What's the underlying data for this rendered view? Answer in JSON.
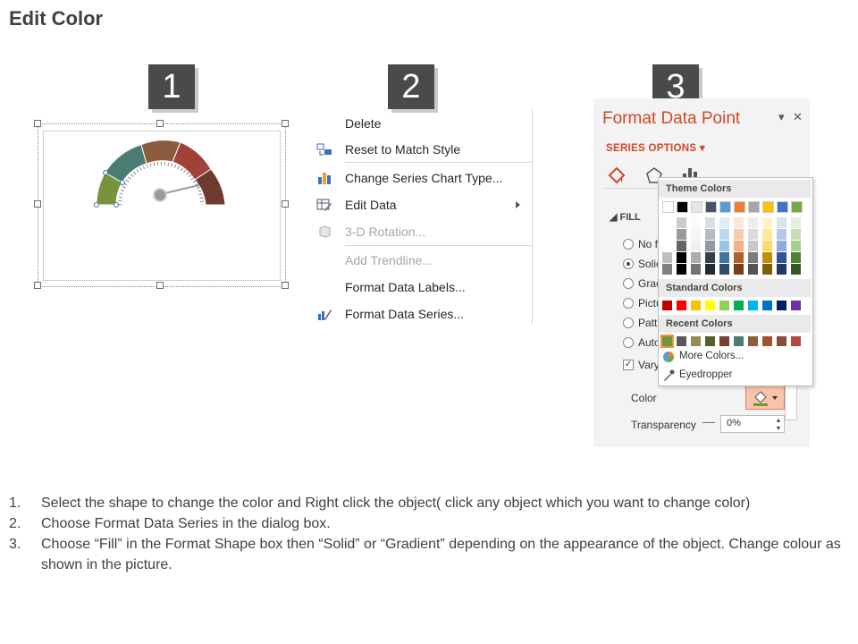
{
  "title": "Edit Color",
  "steps": [
    "1",
    "2",
    "3"
  ],
  "context_menu": {
    "items": [
      {
        "label": "Delete",
        "icon": "none",
        "disabled": false
      },
      {
        "label": "Reset to Match Style",
        "icon": "reset-style-icon",
        "disabled": false
      },
      {
        "label": "Change Series Chart Type...",
        "icon": "bar-chart-icon",
        "disabled": false
      },
      {
        "label": "Edit Data",
        "icon": "edit-data-icon",
        "disabled": false,
        "submenu": true
      },
      {
        "label": "3-D Rotation...",
        "icon": "cube-icon",
        "disabled": true
      },
      {
        "label": "Add Trendline...",
        "icon": "none",
        "disabled": true
      },
      {
        "label": "Format Data Labels...",
        "icon": "none",
        "disabled": false
      },
      {
        "label": "Format Data Series...",
        "icon": "format-series-icon",
        "disabled": false
      }
    ]
  },
  "format_panel": {
    "title": "Format Data Point",
    "series_options": "SERIES OPTIONS",
    "fill_header": "FILL",
    "options": [
      "No f",
      "Solic",
      "Grac",
      "Pictu",
      "Patt",
      "Auto",
      "Vary"
    ],
    "color_label": "Color",
    "transparency_label": "Transparency",
    "transparency_value": "0%"
  },
  "color_dropdown": {
    "theme_header": "Theme Colors",
    "standard_header": "Standard Colors",
    "recent_header": "Recent Colors",
    "more_colors": "More Colors...",
    "eyedropper": "Eyedropper",
    "theme_top": [
      "#ffffff",
      "#000000",
      "#e7e6e6",
      "#44546a",
      "#5b9bd5",
      "#ed7d31",
      "#a5a5a5",
      "#ffc000",
      "#4472c4",
      "#70ad47"
    ],
    "standard": [
      "#c00000",
      "#ff0000",
      "#ffc000",
      "#ffff00",
      "#92d050",
      "#00b050",
      "#00b0f0",
      "#0070c0",
      "#002060",
      "#7030a0"
    ],
    "recent": [
      "#77933c",
      "#595959",
      "#948a54",
      "#4f6228",
      "#7b3f2e",
      "#4a7c73",
      "#8b5d3e",
      "#a0522d",
      "#8b4c39",
      "#b04a3a"
    ]
  },
  "instructions": [
    {
      "num": "1.",
      "text": "Select the shape to change the color and Right click the object( click any object which you want to change color)"
    },
    {
      "num": "2.",
      "text": "Choose Format Data Series in the dialog box."
    },
    {
      "num": "3.",
      "text": "Choose “Fill” in the Format Shape box then “Solid” or “Gradient” depending on the appearance of the object. Change colour as shown in the picture."
    }
  ]
}
